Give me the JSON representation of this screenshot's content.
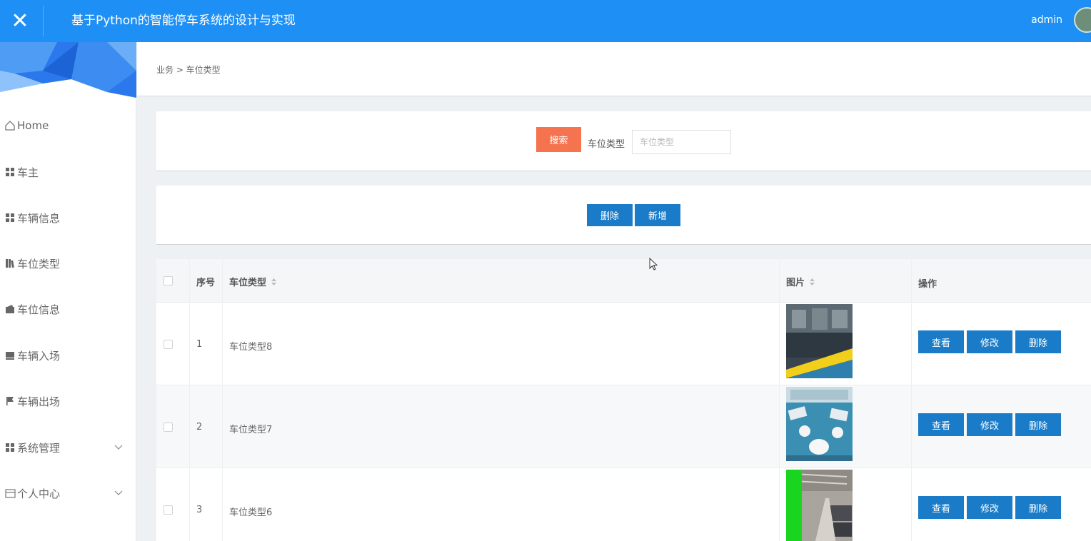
{
  "header": {
    "title": "基于Python的智能停车系统的设计与实现",
    "username": "admin",
    "close_icon": "✕"
  },
  "sidebar": {
    "items": [
      {
        "label": "Home",
        "icon": "home-icon"
      },
      {
        "label": "车主",
        "icon": "grid-icon"
      },
      {
        "label": "车辆信息",
        "icon": "grid-icon"
      },
      {
        "label": "车位类型",
        "icon": "books-icon"
      },
      {
        "label": "车位信息",
        "icon": "wallet-icon"
      },
      {
        "label": "车辆入场",
        "icon": "archive-icon"
      },
      {
        "label": "车辆出场",
        "icon": "flag-icon"
      },
      {
        "label": "系统管理",
        "icon": "grid-icon",
        "expandable": true
      },
      {
        "label": "个人中心",
        "icon": "card-icon",
        "expandable": true
      }
    ]
  },
  "breadcrumb": {
    "text": "业务 > 车位类型"
  },
  "search": {
    "button_label": "搜索",
    "field_label": "车位类型",
    "placeholder": "车位类型",
    "value": ""
  },
  "actions": {
    "delete_label": "删除",
    "add_label": "新增"
  },
  "table": {
    "columns": [
      "序号",
      "车位类型",
      "图片",
      "操作"
    ],
    "row_actions": [
      "查看",
      "修改",
      "删除"
    ],
    "rows": [
      {
        "index": "1",
        "type": "车位类型8",
        "image": "parking-lot-yellow-curb-photo"
      },
      {
        "index": "2",
        "type": "车位类型7",
        "image": "cartoon-parking-lot-illustration"
      },
      {
        "index": "3",
        "type": "车位类型6",
        "image": "underground-garage-photo"
      }
    ]
  },
  "colors": {
    "topbar": "#1e90f5",
    "search_button": "#f6734f",
    "primary_button": "#1a7cc8"
  }
}
